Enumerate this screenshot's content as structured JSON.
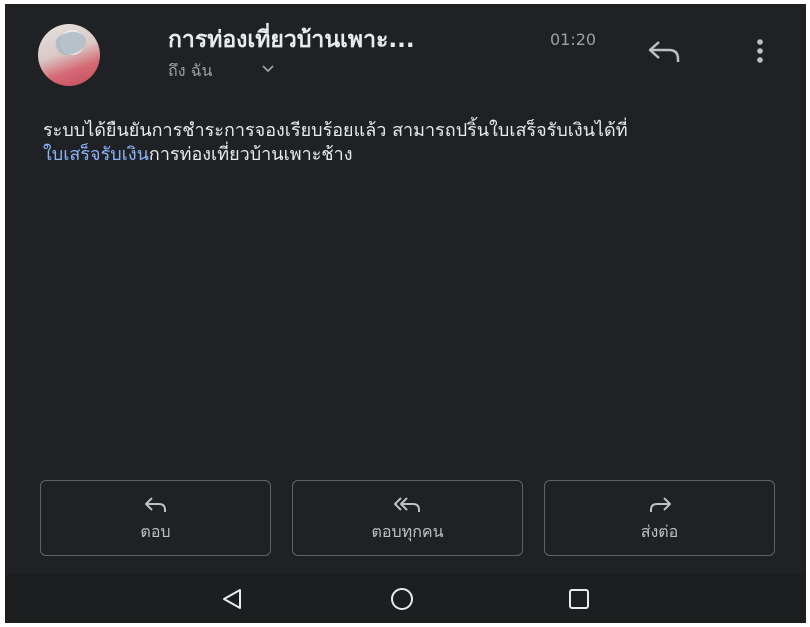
{
  "header": {
    "subject": "การท่องเที่ยวบ้านเพาะ...",
    "time": "01:20",
    "recipient": "ถึง ฉัน"
  },
  "message": {
    "text": "ระบบได้ยืนยันการชำระการจองเรียบร้อยแล้ว สามารถปริ้นใบเสร็จรับเงินได้ที่",
    "link_text": "ใบเสร็จรับเงิน",
    "link_suffix": "การท่องเที่ยวบ้านเพาะช้าง"
  },
  "actions": {
    "reply": "ตอบ",
    "reply_all": "ตอบทุกคน",
    "forward": "ส่งต่อ"
  },
  "colors": {
    "background": "#202124",
    "link": "#8ab4f8",
    "text": "#e8eaed"
  }
}
